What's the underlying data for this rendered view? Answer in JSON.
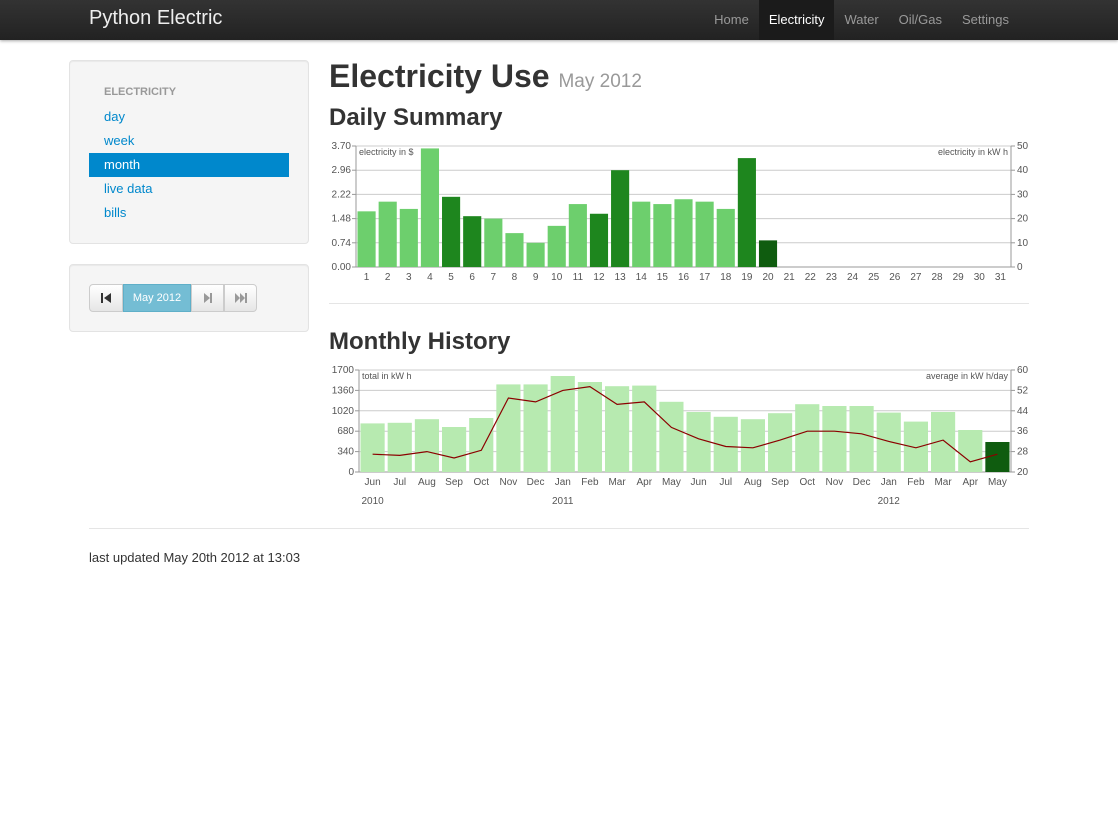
{
  "navbar": {
    "brand": "Python Electric",
    "items": [
      {
        "label": "Home",
        "active": false
      },
      {
        "label": "Electricity",
        "active": true
      },
      {
        "label": "Water",
        "active": false
      },
      {
        "label": "Oil/Gas",
        "active": false
      },
      {
        "label": "Settings",
        "active": false
      }
    ]
  },
  "sidebar": {
    "header": "ELECTRICITY",
    "items": [
      {
        "label": "day",
        "active": false
      },
      {
        "label": "week",
        "active": false
      },
      {
        "label": "month",
        "active": true
      },
      {
        "label": "live data",
        "active": false
      },
      {
        "label": "bills",
        "active": false
      }
    ]
  },
  "pager": {
    "first_icon": "skip-to-start-icon",
    "current": "May 2012",
    "next_icon": "step-forward-icon",
    "last_icon": "fast-forward-icon"
  },
  "page": {
    "title": "Electricity Use",
    "subtitle": "May 2012",
    "daily_heading": "Daily Summary",
    "monthly_heading": "Monthly History",
    "footer": "last updated May 20th 2012 at 13:03"
  },
  "colors": {
    "accent": "#0088cc",
    "bar_light": "#6dcf6d",
    "bar_mid": "#1e861e",
    "bar_dark": "#0f5c0f",
    "history_bar": "#b7eab0",
    "history_current": "#0f5c0f",
    "line": "#8b0000"
  },
  "chart_data": [
    {
      "type": "bar",
      "title": "Daily Summary",
      "y_left_label": "electricity in $",
      "y_right_label": "electricity in kW h",
      "y_left_ticks": [
        "0.00",
        "0.74",
        "1.48",
        "2.22",
        "2.96",
        "3.70"
      ],
      "y_right_ticks": [
        "0",
        "10",
        "20",
        "30",
        "40",
        "50"
      ],
      "ylim": [
        0,
        50
      ],
      "categories": [
        "1",
        "2",
        "3",
        "4",
        "5",
        "6",
        "7",
        "8",
        "9",
        "10",
        "11",
        "12",
        "13",
        "14",
        "15",
        "16",
        "17",
        "18",
        "19",
        "20",
        "21",
        "22",
        "23",
        "24",
        "25",
        "26",
        "27",
        "28",
        "29",
        "30",
        "31"
      ],
      "values": [
        23,
        27,
        24,
        49,
        29,
        21,
        20,
        14,
        10,
        17,
        26,
        22,
        40,
        27,
        26,
        28,
        27,
        24,
        45,
        11,
        0,
        0,
        0,
        0,
        0,
        0,
        0,
        0,
        0,
        0,
        0
      ],
      "shades": [
        "light",
        "light",
        "light",
        "light",
        "mid",
        "mid",
        "light",
        "light",
        "light",
        "light",
        "light",
        "mid",
        "mid",
        "light",
        "light",
        "light",
        "light",
        "light",
        "mid",
        "dark",
        "light",
        "light",
        "light",
        "light",
        "light",
        "light",
        "light",
        "light",
        "light",
        "light",
        "light"
      ],
      "grid": true
    },
    {
      "type": "bar",
      "title": "Monthly History",
      "y_left_label": "total in kW h",
      "y_right_label": "average in kW h/day",
      "y_left_ticks": [
        "0",
        "340",
        "680",
        "1020",
        "1360",
        "1700"
      ],
      "y_right_ticks": [
        "20",
        "28",
        "36",
        "44",
        "52",
        "60"
      ],
      "ylim": [
        0,
        1700
      ],
      "y2lim": [
        20,
        60
      ],
      "categories": [
        "Jun",
        "Jul",
        "Aug",
        "Sep",
        "Oct",
        "Nov",
        "Dec",
        "Jan",
        "Feb",
        "Mar",
        "Apr",
        "May",
        "Jun",
        "Jul",
        "Aug",
        "Sep",
        "Oct",
        "Nov",
        "Dec",
        "Jan",
        "Feb",
        "Mar",
        "Apr",
        "May"
      ],
      "years": [
        {
          "label": "2010",
          "index": 0
        },
        {
          "label": "2011",
          "index": 7
        },
        {
          "label": "2012",
          "index": 19
        }
      ],
      "series": [
        {
          "values": [
            810,
            820,
            880,
            750,
            900,
            1460,
            1460,
            1600,
            1500,
            1430,
            1440,
            1170,
            1000,
            920,
            880,
            980,
            1130,
            1100,
            1100,
            990,
            840,
            1000,
            700,
            500
          ]
        },
        {
          "values": [
            27,
            26.5,
            28,
            25.5,
            28.5,
            49,
            47.5,
            52,
            53.5,
            46.5,
            47.5,
            37.5,
            33,
            30,
            29.5,
            32.5,
            36,
            36,
            35,
            32,
            29.5,
            32.5,
            24,
            27
          ]
        }
      ],
      "grid": true
    }
  ]
}
